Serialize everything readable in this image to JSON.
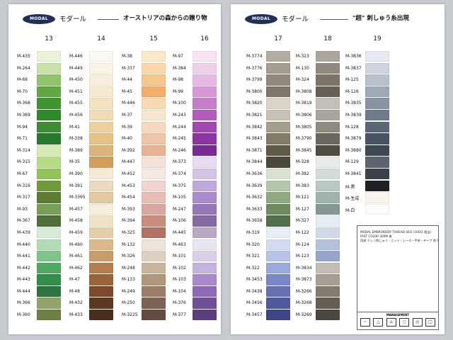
{
  "panels": [
    {
      "logo": "MODAL",
      "name": "モダール",
      "tagline": "オーストリアの森からの贈り物",
      "columns": [
        {
          "number": "13",
          "items": [
            {
              "code": "M-435",
              "color": "#eaf3d8"
            },
            {
              "code": "M-264",
              "color": "#c8e2a8"
            },
            {
              "code": "M-69",
              "color": "#8fc46d"
            },
            {
              "code": "M-70",
              "color": "#5fa842"
            },
            {
              "code": "M-368",
              "color": "#3f9630"
            },
            {
              "code": "M-369",
              "color": "#2f8a2a"
            },
            {
              "code": "M-94",
              "color": "#3e8d35"
            },
            {
              "code": "M-71",
              "color": "#27792d"
            },
            {
              "code": "M-314",
              "color": "#d6eab5"
            },
            {
              "code": "M-315",
              "color": "#b7dc86"
            },
            {
              "code": "M-67",
              "color": "#93c45a"
            },
            {
              "code": "M-316",
              "color": "#6f9c38"
            },
            {
              "code": "M-317",
              "color": "#5b7d30"
            },
            {
              "code": "M-93",
              "color": "#779f5a"
            },
            {
              "code": "M-367",
              "color": "#4f6f3a"
            },
            {
              "code": "M-439",
              "color": "#d5ecd6"
            },
            {
              "code": "M-440",
              "color": "#b2dcb4"
            },
            {
              "code": "M-441",
              "color": "#7dc38a"
            },
            {
              "code": "M-442",
              "color": "#4faa5f"
            },
            {
              "code": "M-443",
              "color": "#2f8f46"
            },
            {
              "code": "M-444",
              "color": "#2a7540"
            },
            {
              "code": "M-366",
              "color": "#91a56a"
            },
            {
              "code": "M-360",
              "color": "#6d7f42"
            }
          ]
        },
        {
          "number": "14",
          "items": [
            {
              "code": "M-446",
              "color": "#faf8f2"
            },
            {
              "code": "M-449",
              "color": "#f8f4e6"
            },
            {
              "code": "M-450",
              "color": "#f6efdc"
            },
            {
              "code": "M-451",
              "color": "#f5ead0"
            },
            {
              "code": "M-455",
              "color": "#f4e3c2"
            },
            {
              "code": "M-456",
              "color": "#f2dbb2"
            },
            {
              "code": "M-41",
              "color": "#eed09c"
            },
            {
              "code": "M-338",
              "color": "#e7c286"
            },
            {
              "code": "M-389",
              "color": "#ddb47a"
            },
            {
              "code": "M-35",
              "color": "#d39e5a"
            },
            {
              "code": "M-390",
              "color": "#f4ead6"
            },
            {
              "code": "M-391",
              "color": "#ebdabd"
            },
            {
              "code": "M-3365",
              "color": "#e2c9a0"
            },
            {
              "code": "M-457",
              "color": "#f6efdf"
            },
            {
              "code": "M-458",
              "color": "#f1e2c7"
            },
            {
              "code": "M-459",
              "color": "#e6cfa8"
            },
            {
              "code": "M-460",
              "color": "#d9b98c"
            },
            {
              "code": "M-461",
              "color": "#c99c6c"
            },
            {
              "code": "M-462",
              "color": "#b57e4d"
            },
            {
              "code": "M-47",
              "color": "#9a6338"
            },
            {
              "code": "M-48",
              "color": "#7c4a2a"
            },
            {
              "code": "M-432",
              "color": "#5e3822"
            },
            {
              "code": "M-433",
              "color": "#4a2d1c"
            }
          ]
        },
        {
          "number": "15",
          "items": [
            {
              "code": "M-38",
              "color": "#fde9c7"
            },
            {
              "code": "M-337",
              "color": "#fbd8aa"
            },
            {
              "code": "M-44",
              "color": "#f8c68a"
            },
            {
              "code": "M-45",
              "color": "#f3ae6a"
            },
            {
              "code": "M-446",
              "color": "#f7d9b2"
            },
            {
              "code": "M-37",
              "color": "#f8e6cf"
            },
            {
              "code": "M-39",
              "color": "#f6d7bf"
            },
            {
              "code": "M-40",
              "color": "#f0c4a7"
            },
            {
              "code": "M-392",
              "color": "#e9b293"
            },
            {
              "code": "M-447",
              "color": "#f5e0d6"
            },
            {
              "code": "M-452",
              "color": "#f7e8e6"
            },
            {
              "code": "M-453",
              "color": "#f1d3cf"
            },
            {
              "code": "M-454",
              "color": "#e8bdb3"
            },
            {
              "code": "M-393",
              "color": "#d9a79e"
            },
            {
              "code": "M-394",
              "color": "#c98d7e"
            },
            {
              "code": "M-325",
              "color": "#b27163"
            },
            {
              "code": "M-132",
              "color": "#ece3d9"
            },
            {
              "code": "M-326",
              "color": "#ddd0c1"
            },
            {
              "code": "M-248",
              "color": "#c9b59d"
            },
            {
              "code": "M-133",
              "color": "#b0967a"
            },
            {
              "code": "M-249",
              "color": "#9c7e68"
            },
            {
              "code": "M-250",
              "color": "#7e6254"
            },
            {
              "code": "M-3225",
              "color": "#664b42"
            }
          ]
        },
        {
          "number": "16",
          "items": [
            {
              "code": "M-97",
              "color": "#f7e6f2"
            },
            {
              "code": "M-384",
              "color": "#efd0ea"
            },
            {
              "code": "M-98",
              "color": "#e5b9e1"
            },
            {
              "code": "M-99",
              "color": "#d797d6"
            },
            {
              "code": "M-100",
              "color": "#c57cc9"
            },
            {
              "code": "M-243",
              "color": "#b45cbd"
            },
            {
              "code": "M-244",
              "color": "#a147b0"
            },
            {
              "code": "M-245",
              "color": "#8c35a2"
            },
            {
              "code": "M-246",
              "color": "#7a2a94"
            },
            {
              "code": "M-373",
              "color": "#e7dbef"
            },
            {
              "code": "M-374",
              "color": "#d5c3e6"
            },
            {
              "code": "M-375",
              "color": "#c1a8da"
            },
            {
              "code": "M-105",
              "color": "#ab8bcb"
            },
            {
              "code": "M-247",
              "color": "#9776b8"
            },
            {
              "code": "M-106",
              "color": "#836aa2"
            },
            {
              "code": "M-445",
              "color": "#b9a9c4"
            },
            {
              "code": "M-463",
              "color": "#e9e4f1"
            },
            {
              "code": "M-101",
              "color": "#d9cfe8"
            },
            {
              "code": "M-102",
              "color": "#c4b3dd"
            },
            {
              "code": "M-103",
              "color": "#a88acb"
            },
            {
              "code": "M-104",
              "color": "#8f69b8"
            },
            {
              "code": "M-376",
              "color": "#6f4e9a"
            },
            {
              "code": "M-377",
              "color": "#5a3f7e"
            }
          ]
        }
      ]
    },
    {
      "logo": "MODAL",
      "name": "モダール",
      "tagline": "\"超\" 刺しゅう糸出現",
      "columns": [
        {
          "number": "17",
          "items": [
            {
              "code": "M-3774",
              "color": "#b3aca2"
            },
            {
              "code": "M-3776",
              "color": "#a39c91"
            },
            {
              "code": "M-3799",
              "color": "#8f887d"
            },
            {
              "code": "M-3800",
              "color": "#7d766b"
            },
            {
              "code": "M-3820",
              "color": "#d9d5cb"
            },
            {
              "code": "M-3821",
              "color": "#c7c2b5"
            },
            {
              "code": "M-3842",
              "color": "#a29f8c"
            },
            {
              "code": "M-3843",
              "color": "#807c66"
            },
            {
              "code": "M-3871",
              "color": "#5d5a48"
            },
            {
              "code": "M-3844",
              "color": "#4a4838"
            },
            {
              "code": "M-3636",
              "color": "#d9e2d0"
            },
            {
              "code": "M-3639",
              "color": "#b6c6a8"
            },
            {
              "code": "M-3632",
              "color": "#8faa80"
            },
            {
              "code": "M-3633",
              "color": "#6e8b60"
            },
            {
              "code": "M-3658",
              "color": "#54704a"
            },
            {
              "code": "M-319",
              "color": "#e9edf7"
            },
            {
              "code": "M-320",
              "color": "#d3dbf0"
            },
            {
              "code": "M-321",
              "color": "#b7c4e8"
            },
            {
              "code": "M-322",
              "color": "#9aa8dc"
            },
            {
              "code": "M-3453",
              "color": "#7b86c6"
            },
            {
              "code": "M-3438",
              "color": "#6670b2"
            },
            {
              "code": "M-3456",
              "color": "#4f5a9c"
            },
            {
              "code": "M-3457",
              "color": "#3d4586"
            }
          ]
        },
        {
          "number": "18",
          "items": [
            {
              "code": "M-323",
              "color": "#aba59c"
            },
            {
              "code": "M-130",
              "color": "#8f897f"
            },
            {
              "code": "M-324",
              "color": "#7a7469"
            },
            {
              "code": "M-3808",
              "color": "#666157"
            },
            {
              "code": "M-3819",
              "color": "#c4c0b6"
            },
            {
              "code": "M-3806",
              "color": "#a9a59b"
            },
            {
              "code": "M-3805",
              "color": "#8e8a7f"
            },
            {
              "code": "M-3790",
              "color": "#6a675c"
            },
            {
              "code": "M-3845",
              "color": "#4e4c43"
            },
            {
              "code": "M-328",
              "color": "#e7ece8"
            },
            {
              "code": "M-382",
              "color": "#d3ddd7"
            },
            {
              "code": "M-383",
              "color": "#b9c8c2"
            },
            {
              "code": "M-121",
              "color": "#9fb3ad"
            },
            {
              "code": "M-127",
              "color": "#839a94"
            },
            {
              "code": "M-327",
              "color": "#e6ecf4"
            },
            {
              "code": "M-122",
              "color": "#cfd9e9"
            },
            {
              "code": "M-124",
              "color": "#b3c1dc"
            },
            {
              "code": "M-123",
              "color": "#95a5cb"
            },
            {
              "code": "M-3834",
              "color": "#c2bdb4"
            },
            {
              "code": "M-3873",
              "color": "#a49e93"
            },
            {
              "code": "M-3266",
              "color": "#817b70"
            },
            {
              "code": "M-3268",
              "color": "#635d53"
            },
            {
              "code": "M-3269",
              "color": "#4b463f"
            }
          ]
        },
        {
          "number": "19",
          "items": [
            {
              "code": "M-3836",
              "color": "#e6e9ef"
            },
            {
              "code": "M-3837",
              "color": "#cfd5de"
            },
            {
              "code": "M-125",
              "color": "#b7c0cd"
            },
            {
              "code": "M-126",
              "color": "#9fa9b8"
            },
            {
              "code": "M-3835",
              "color": "#8893a3"
            },
            {
              "code": "M-3839",
              "color": "#6f7b8c"
            },
            {
              "code": "M-128",
              "color": "#596676"
            },
            {
              "code": "M-3879",
              "color": "#485463"
            },
            {
              "code": "M-3880",
              "color": "#3d4854"
            },
            {
              "code": "M-129",
              "color": "#5c6470"
            },
            {
              "code": "M-3841",
              "color": "#3c4149"
            },
            {
              "code": "M-黒",
              "color": "#1e2024"
            },
            {
              "code": "M-生成",
              "color": "#f6f4ec"
            },
            {
              "code": "M-白",
              "color": "#fcfcfc"
            }
          ]
        }
      ],
      "info": {
        "lines": [
          "MODAL EMBROIDERY THREAD 40/2 (100/2 相当)",
          "FAST COLOR 300M 巻",
          "用途 ミシン刺しゅう・ニット・レース・手芸・テープ 他 等"
        ],
        "management_label": "MANAGEMENT",
        "care_icons": [
          "wash-icon",
          "bleach-icon",
          "iron-icon",
          "dryclean-icon",
          "tumble-icon",
          "dry-icon"
        ]
      }
    }
  ]
}
